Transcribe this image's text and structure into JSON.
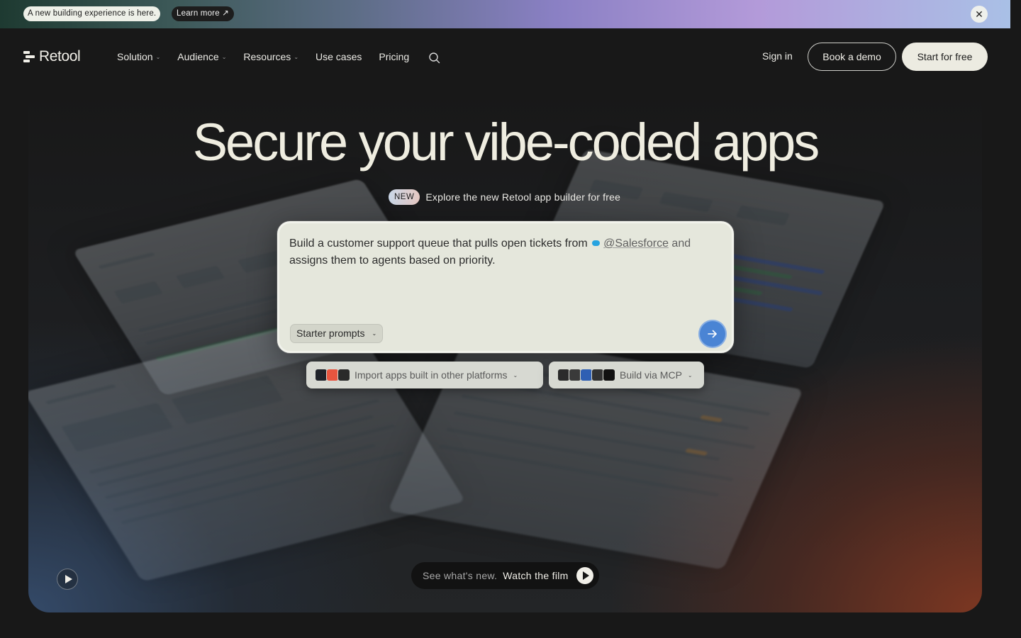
{
  "announcement": {
    "text": "A new building experience is here.",
    "link_label": "Learn more ↗",
    "close_icon": "close-icon"
  },
  "header": {
    "logo_text": "Retool",
    "nav": [
      {
        "label": "Solution",
        "has_dropdown": true
      },
      {
        "label": "Audience",
        "has_dropdown": true
      },
      {
        "label": "Resources",
        "has_dropdown": true
      },
      {
        "label": "Use cases",
        "has_dropdown": false
      },
      {
        "label": "Pricing",
        "has_dropdown": false
      }
    ],
    "search_icon": "search-icon",
    "sign_in": "Sign in",
    "book_demo": "Book a demo",
    "start_free": "Start for free"
  },
  "hero": {
    "title": "Secure your vibe-coded apps",
    "badge": "NEW",
    "subtitle": "Explore the new Retool app builder for free",
    "prompt": {
      "text_1": "Build a customer support queue that pulls open tickets from",
      "mention": "@Salesforce",
      "text_2": " and",
      "text_3": "assigns them to agents based on priority.",
      "starter_label": "Starter prompts",
      "send_icon": "arrow-right-icon"
    },
    "import_button": "Import apps built in other platforms",
    "mcp_button": "Build via MCP",
    "film": {
      "see": "See what's new.",
      "watch": "Watch the film"
    },
    "play_icon": "play-icon"
  },
  "colors": {
    "background": "#181818",
    "accent_send": "#4a84d4",
    "prompt_bg": "#e5e7dc",
    "start_button_bg": "#ecebe1"
  }
}
